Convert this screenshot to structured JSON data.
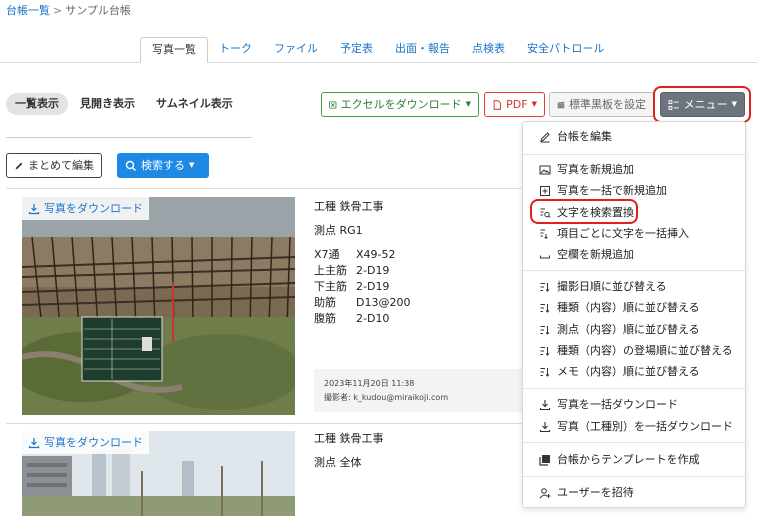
{
  "breadcrumb": {
    "parent": "台帳一覧",
    "separator": ">",
    "current": "サンプル台帳"
  },
  "tabs": [
    "写真一覧",
    "トーク",
    "ファイル",
    "予定表",
    "出面・報告",
    "点検表",
    "安全パトロール"
  ],
  "view_modes": [
    "一覧表示",
    "見開き表示",
    "サムネイル表示"
  ],
  "toolbar": {
    "excel_label": "エクセルをダウンロード",
    "pdf_label": "PDF",
    "board_label": "標準黒板を設定",
    "menu_label": "メニュー",
    "bulk_edit_label": "まとめて編集",
    "search_label": "検索する"
  },
  "photos": [
    {
      "download_label": "写真をダウンロード",
      "title": "工種 鉄骨工事",
      "point": "測点 RG1",
      "details": [
        {
          "key": "X7通",
          "value": "X49-52"
        },
        {
          "key": "上主筋",
          "value": "2-D19"
        },
        {
          "key": "下主筋",
          "value": "2-D19"
        },
        {
          "key": "助筋",
          "value": "D13@200"
        },
        {
          "key": "腹筋",
          "value": "2-D10"
        }
      ],
      "date": "2023年11月20日 11:38",
      "photographer": "撮影者: k_kudou@miraikoji.com"
    },
    {
      "download_label": "写真をダウンロード",
      "title": "工種 鉄骨工事",
      "point": "測点 全体"
    }
  ],
  "menu_items": [
    {
      "icon": "pencil-icon",
      "label": "台帳を編集"
    },
    {
      "icon": "add-photo-icon",
      "label": "写真を新規追加"
    },
    {
      "icon": "bulk-add-icon",
      "label": "写真を一括で新規追加"
    },
    {
      "icon": "find-replace-icon",
      "label": "文字を検索置換"
    },
    {
      "icon": "text-insert-icon",
      "label": "項目ごとに文字を一括挿入"
    },
    {
      "icon": "blank-icon",
      "label": "空欄を新規追加"
    },
    {
      "icon": "sort-icon",
      "label": "撮影日順に並び替える"
    },
    {
      "icon": "sort-icon",
      "label": "種類（内容）順に並び替える"
    },
    {
      "icon": "sort-icon",
      "label": "測点（内容）順に並び替える"
    },
    {
      "icon": "sort-icon",
      "label": "種類（内容）の登場順に並び替える"
    },
    {
      "icon": "sort-icon",
      "label": "メモ（内容）順に並び替える"
    },
    {
      "icon": "download-icon",
      "label": "写真を一括ダウンロード"
    },
    {
      "icon": "download-icon",
      "label": "写真（工種別）を一括ダウンロード"
    },
    {
      "icon": "template-icon",
      "label": "台帳からテンプレートを作成"
    },
    {
      "icon": "invite-user-icon",
      "label": "ユーザーを招待"
    }
  ],
  "colors": {
    "link": "#1a73c9",
    "excel": "#2e7d32",
    "pdf": "#d32f2f",
    "menu_bg": "#6c757d",
    "search_bg": "#1e88e5",
    "highlight": "#e0201a"
  }
}
